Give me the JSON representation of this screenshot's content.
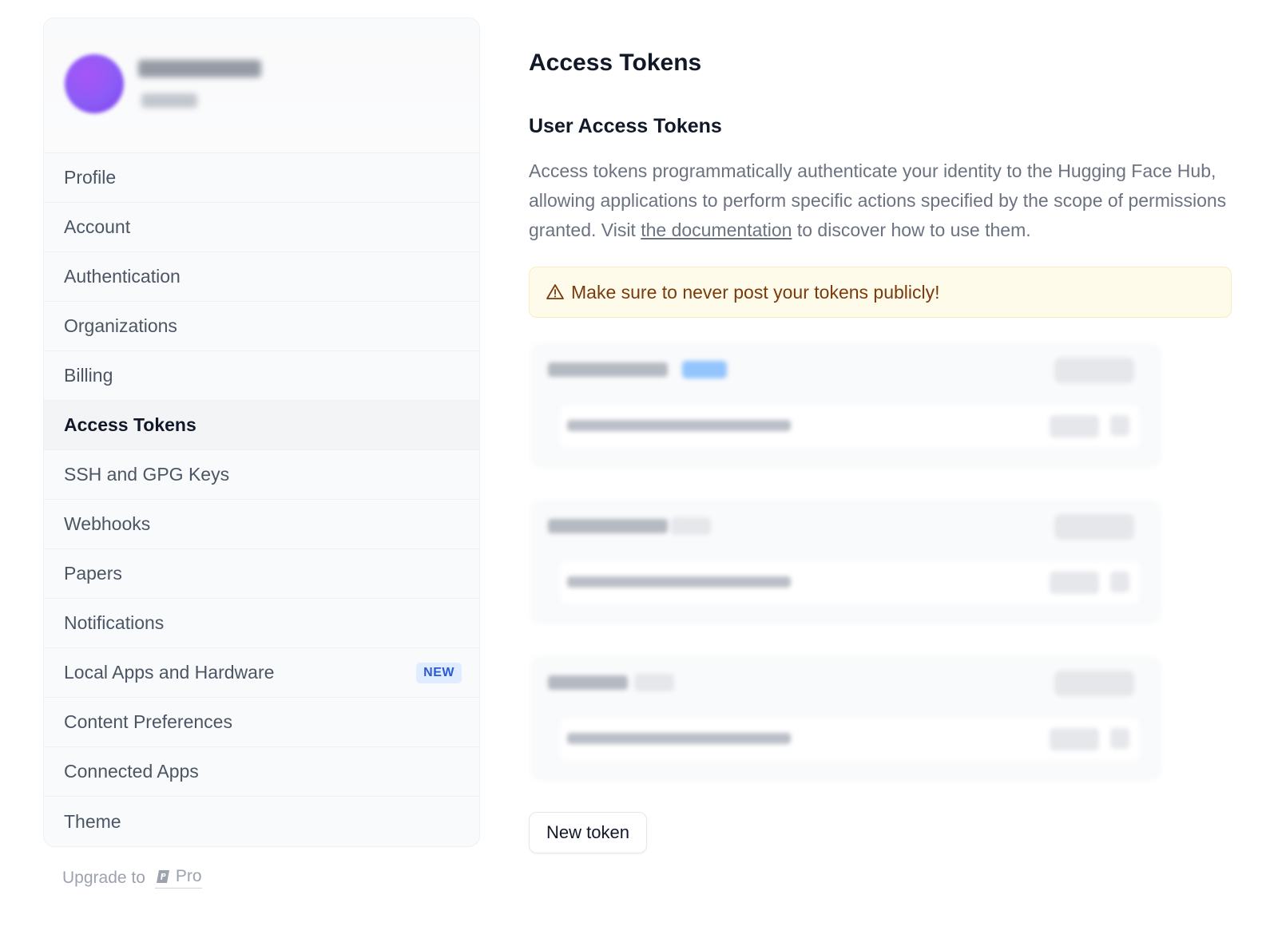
{
  "sidebar": {
    "items": [
      {
        "label": "Profile"
      },
      {
        "label": "Account"
      },
      {
        "label": "Authentication"
      },
      {
        "label": "Organizations"
      },
      {
        "label": "Billing"
      },
      {
        "label": "Access Tokens",
        "active": true
      },
      {
        "label": "SSH and GPG Keys"
      },
      {
        "label": "Webhooks"
      },
      {
        "label": "Papers"
      },
      {
        "label": "Notifications"
      },
      {
        "label": "Local Apps and Hardware",
        "badge": "NEW"
      },
      {
        "label": "Content Preferences"
      },
      {
        "label": "Connected Apps"
      },
      {
        "label": "Theme"
      }
    ],
    "upgrade": {
      "prefix": "Upgrade to",
      "pro_label": "Pro"
    }
  },
  "main": {
    "title": "Access Tokens",
    "section_title": "User Access Tokens",
    "description": {
      "before_link": "Access tokens programmatically authenticate your identity to the Hugging Face Hub, allowing applications to perform specific actions specified by the scope of permissions granted. Visit ",
      "link_text": "the documentation",
      "after_link": " to discover how to use them."
    },
    "warning": "Make sure to never post your tokens publicly!",
    "new_token_label": "New token"
  },
  "colors": {
    "accent_badge_bg": "#e0ecff",
    "accent_badge_text": "#2a5bd7",
    "warning_bg": "#fefbea",
    "warning_text": "#7a3a0c",
    "avatar": "#8b5cf6"
  },
  "icons": {
    "warning": "warning-triangle-icon",
    "pro": "pro-badge-icon"
  }
}
